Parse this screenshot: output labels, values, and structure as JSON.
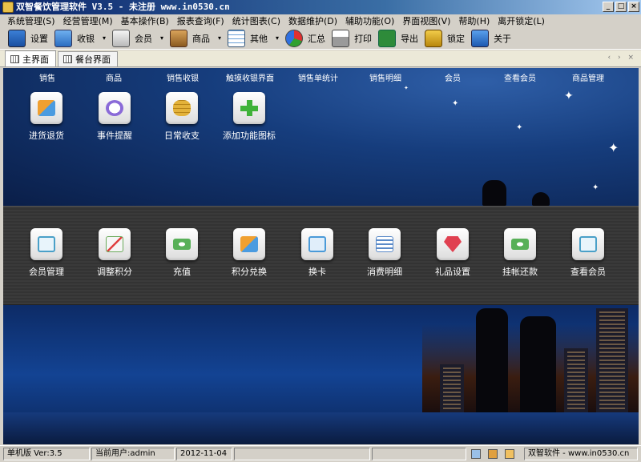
{
  "window": {
    "title": "双智餐饮管理软件 V3.5  - 未注册 www.in0530.cn",
    "controls": {
      "minimize": "_",
      "maximize": "□",
      "close": "×"
    }
  },
  "menu": [
    "系统管理(S)",
    "经营管理(M)",
    "基本操作(B)",
    "报表查询(F)",
    "统计图表(C)",
    "数据维护(D)",
    "辅助功能(O)",
    "界面视图(V)",
    "帮助(H)",
    "离开锁定(L)"
  ],
  "toolbar": {
    "settings": "设置",
    "cashier": "收银",
    "member": "会员",
    "goods": "商品",
    "other": "其他",
    "summary": "汇总",
    "print": "打印",
    "export": "导出",
    "lock": "锁定",
    "about": "关于",
    "dropdown_arrow": "▾"
  },
  "tabs": [
    {
      "label": "主界面",
      "active": true
    },
    {
      "label": "餐台界面",
      "active": false
    }
  ],
  "tab_nav": "‹ › ×",
  "top_links": [
    "销售",
    "商品",
    "销售收银",
    "触摸收银界面",
    "销售单统计",
    "销售明细",
    "会员",
    "查看会员",
    "商品管理"
  ],
  "top_launchers": [
    {
      "label": "进货退货",
      "icon": "boxes-icon",
      "color": "#4a9be0"
    },
    {
      "label": "事件提醒",
      "icon": "clock-icon",
      "color": "#8a6ad8"
    },
    {
      "label": "日常收支",
      "icon": "coins-icon",
      "color": "#e3b23a"
    },
    {
      "label": "添加功能图标",
      "icon": "plus-icon",
      "color": "#3fb23a"
    }
  ],
  "band_launchers": [
    {
      "label": "会员管理",
      "icon": "member-card-icon",
      "color": "#4aa0c8"
    },
    {
      "label": "调整积分",
      "icon": "chart-icon",
      "color": "#6aaa5a"
    },
    {
      "label": "充值",
      "icon": "money-icon",
      "color": "#58b058"
    },
    {
      "label": "积分兑换",
      "icon": "boxes-icon",
      "color": "#e0a040"
    },
    {
      "label": "换卡",
      "icon": "id-card-icon",
      "color": "#4a9ad8"
    },
    {
      "label": "消费明细",
      "icon": "list-icon",
      "color": "#5a8ac8"
    },
    {
      "label": "礼品设置",
      "icon": "gem-icon",
      "color": "#e04050"
    },
    {
      "label": "挂帐还款",
      "icon": "money-icon",
      "color": "#58b058"
    },
    {
      "label": "查看会员",
      "icon": "member-card-icon",
      "color": "#4aa0c8"
    }
  ],
  "status": {
    "edition": "单机版 Ver:3.5",
    "user": "当前用户:admin",
    "date": "2012-11-04",
    "brand": "双智软件 - www.in0530.cn"
  }
}
